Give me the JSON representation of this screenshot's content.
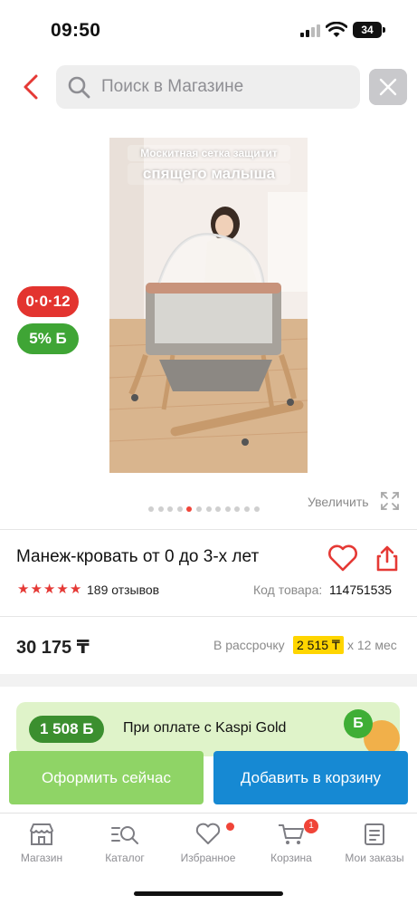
{
  "status_bar": {
    "time": "09:50",
    "battery": "34"
  },
  "search": {
    "placeholder": "Поиск в Магазине"
  },
  "product_image": {
    "caption_line1": "Москитная сетка защитит",
    "caption_line2": "спящего малыша"
  },
  "badges": {
    "installment": "0·0·12",
    "bonus": "5% Б"
  },
  "gallery": {
    "slide_count": 12,
    "active_index": 4,
    "zoom_label": "Увеличить"
  },
  "product": {
    "title": "Манеж-кровать от 0 до 3-х лет",
    "rating": 5,
    "reviews": "189 отзывов",
    "sku_label": "Код товара:",
    "sku_value": "114751535"
  },
  "pricing": {
    "price": "30 175 ₸",
    "installment_label": "В рассрочку",
    "installment_amount": "2 515 ₸",
    "installment_term": "х 12 мес"
  },
  "kaspi_gold": {
    "bonus_amount": "1 508 Б",
    "text": "При оплате с Kaspi Gold",
    "coin_letter": "Б"
  },
  "actions": {
    "order_now": "Оформить сейчас",
    "add_to_cart": "Добавить в корзину"
  },
  "tab_bar": {
    "items": [
      {
        "label": "Магазин",
        "icon": "store-icon"
      },
      {
        "label": "Каталог",
        "icon": "catalog-icon"
      },
      {
        "label": "Избранное",
        "icon": "heart-icon"
      },
      {
        "label": "Корзина",
        "icon": "cart-icon",
        "badge": "1"
      },
      {
        "label": "Мои заказы",
        "icon": "orders-icon"
      }
    ]
  },
  "colors": {
    "accent_red": "#e3342f",
    "bonus_green": "#3fa535",
    "order_button": "#8fd466",
    "cart_button": "#1689d3",
    "installment_highlight": "#ffd500"
  }
}
